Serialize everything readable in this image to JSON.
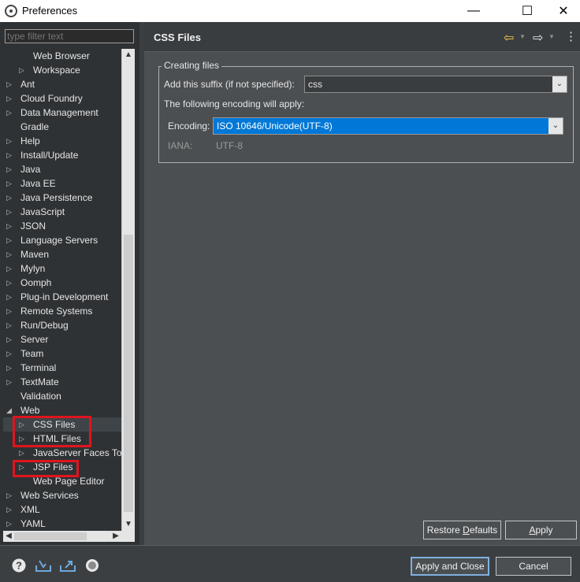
{
  "window": {
    "title": "Preferences"
  },
  "filter": {
    "placeholder": "type filter text"
  },
  "tree": {
    "items": [
      {
        "label": "Web Browser",
        "level": 1,
        "twisty": ""
      },
      {
        "label": "Workspace",
        "level": 1,
        "twisty": "▷"
      },
      {
        "label": "Ant",
        "level": 0,
        "twisty": "▷"
      },
      {
        "label": "Cloud Foundry",
        "level": 0,
        "twisty": "▷"
      },
      {
        "label": "Data Management",
        "level": 0,
        "twisty": "▷"
      },
      {
        "label": "Gradle",
        "level": 0,
        "twisty": ""
      },
      {
        "label": "Help",
        "level": 0,
        "twisty": "▷"
      },
      {
        "label": "Install/Update",
        "level": 0,
        "twisty": "▷"
      },
      {
        "label": "Java",
        "level": 0,
        "twisty": "▷"
      },
      {
        "label": "Java EE",
        "level": 0,
        "twisty": "▷"
      },
      {
        "label": "Java Persistence",
        "level": 0,
        "twisty": "▷"
      },
      {
        "label": "JavaScript",
        "level": 0,
        "twisty": "▷"
      },
      {
        "label": "JSON",
        "level": 0,
        "twisty": "▷"
      },
      {
        "label": "Language Servers",
        "level": 0,
        "twisty": "▷"
      },
      {
        "label": "Maven",
        "level": 0,
        "twisty": "▷"
      },
      {
        "label": "Mylyn",
        "level": 0,
        "twisty": "▷"
      },
      {
        "label": "Oomph",
        "level": 0,
        "twisty": "▷"
      },
      {
        "label": "Plug-in Development",
        "level": 0,
        "twisty": "▷"
      },
      {
        "label": "Remote Systems",
        "level": 0,
        "twisty": "▷"
      },
      {
        "label": "Run/Debug",
        "level": 0,
        "twisty": "▷"
      },
      {
        "label": "Server",
        "level": 0,
        "twisty": "▷"
      },
      {
        "label": "Team",
        "level": 0,
        "twisty": "▷"
      },
      {
        "label": "Terminal",
        "level": 0,
        "twisty": "▷"
      },
      {
        "label": "TextMate",
        "level": 0,
        "twisty": "▷"
      },
      {
        "label": "Validation",
        "level": 0,
        "twisty": ""
      },
      {
        "label": "Web",
        "level": 0,
        "twisty": "◢"
      },
      {
        "label": "CSS Files",
        "level": 1,
        "twisty": "▷",
        "selected": true
      },
      {
        "label": "HTML Files",
        "level": 1,
        "twisty": "▷"
      },
      {
        "label": "JavaServer Faces Tools",
        "level": 1,
        "twisty": "▷"
      },
      {
        "label": "JSP Files",
        "level": 1,
        "twisty": "▷"
      },
      {
        "label": "Web Page Editor",
        "level": 1,
        "twisty": ""
      },
      {
        "label": "Web Services",
        "level": 0,
        "twisty": "▷"
      },
      {
        "label": "XML",
        "level": 0,
        "twisty": "▷"
      },
      {
        "label": "YAML",
        "level": 0,
        "twisty": "▷"
      }
    ]
  },
  "page": {
    "title": "CSS Files",
    "group_label": "Creating files",
    "suffix_label": "Add this suffix (if not specified):",
    "suffix_value": "css",
    "encoding_note": "The following encoding will apply:",
    "encoding_label": "Encoding:",
    "encoding_value": "ISO 10646/Unicode(UTF-8)",
    "iana_label": "IANA:",
    "iana_value": "UTF-8",
    "restore_prefix": "Restore ",
    "restore_underlined": "D",
    "restore_suffix": "efaults",
    "apply_underlined": "A",
    "apply_suffix": "pply"
  },
  "footer": {
    "apply_close": "Apply and Close",
    "cancel": "Cancel"
  },
  "colors": {
    "highlight_box": "#e0141e",
    "selection_blue": "#0078d7",
    "back_arrow": "#f2c94c"
  }
}
